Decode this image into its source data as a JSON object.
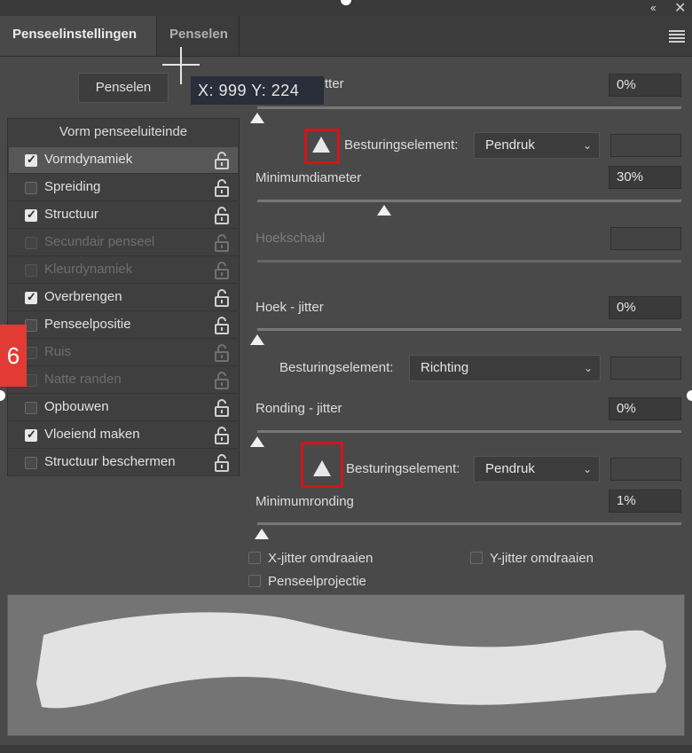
{
  "window": {
    "collapse_glyph": "‹‹",
    "close_glyph": "✕"
  },
  "tabs": [
    {
      "label": "Penseelinstellingen",
      "active": true
    },
    {
      "label": "Penselen",
      "active": false
    }
  ],
  "toolbar": {
    "penselen_button": "Penselen",
    "tooltip": "X: 999 Y: 224"
  },
  "side_tab_label": "6",
  "left_panel": {
    "header": "Vorm penseeluiteinde",
    "options": [
      {
        "label": "Vormdynamiek",
        "checked": true,
        "enabled": true,
        "selected": true
      },
      {
        "label": "Spreiding",
        "checked": false,
        "enabled": true
      },
      {
        "label": "Structuur",
        "checked": true,
        "enabled": true
      },
      {
        "label": "Secundair penseel",
        "checked": false,
        "enabled": false
      },
      {
        "label": "Kleurdynamiek",
        "checked": false,
        "enabled": false
      },
      {
        "label": "Overbrengen",
        "checked": true,
        "enabled": true
      },
      {
        "label": "Penseelpositie",
        "checked": false,
        "enabled": true
      },
      {
        "label": "Ruis",
        "checked": false,
        "enabled": false
      },
      {
        "label": "Natte randen",
        "checked": false,
        "enabled": false
      },
      {
        "label": "Opbouwen",
        "checked": false,
        "enabled": true
      },
      {
        "label": "Vloeiend maken",
        "checked": true,
        "enabled": true
      },
      {
        "label": "Structuur beschermen",
        "checked": false,
        "enabled": true
      }
    ]
  },
  "settings": {
    "size_jitter": {
      "label_visible": "tter",
      "value": "0%"
    },
    "control1": {
      "label": "Besturingselement:",
      "value": "Pendruk"
    },
    "min_diameter": {
      "label": "Minimumdiameter",
      "value": "30%",
      "level": 0.3
    },
    "tilt_scale": {
      "label": "Hoekschaal"
    },
    "angle_jitter": {
      "label": "Hoek - jitter",
      "value": "0%"
    },
    "control2": {
      "label": "Besturingselement:",
      "value": "Richting"
    },
    "roundness_jitter": {
      "label": "Ronding - jitter",
      "value": "0%"
    },
    "control3": {
      "label": "Besturingselement:",
      "value": "Pendruk"
    },
    "min_roundness": {
      "label": "Minimumronding",
      "value": "1%",
      "level": 0.01
    },
    "flip_x": {
      "label": "X-jitter omdraaien",
      "checked": false
    },
    "flip_y": {
      "label": "Y-jitter omdraaien",
      "checked": false
    },
    "projection": {
      "label": "Penseelprojectie",
      "checked": false
    }
  },
  "colors": {
    "warning_outline": "#d4141a",
    "side_tab": "#e23a35"
  }
}
